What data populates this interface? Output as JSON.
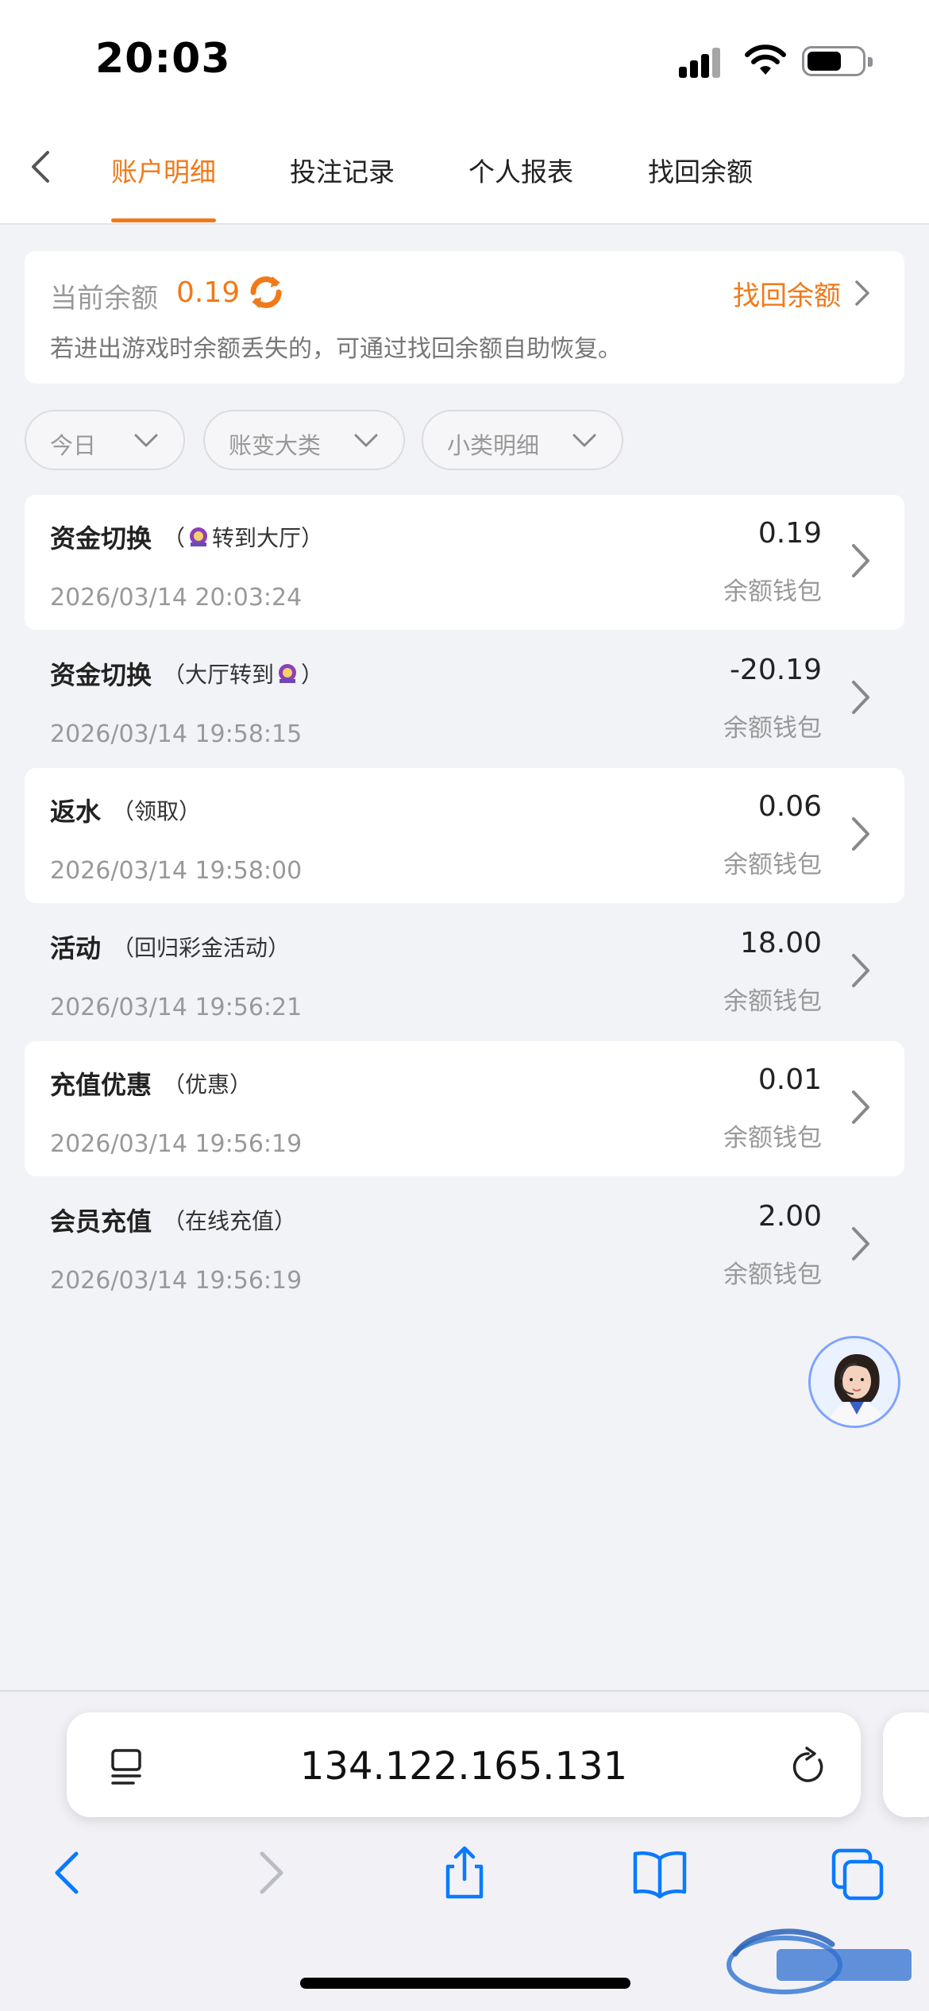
{
  "status_bar": {
    "time": "20:03"
  },
  "header": {
    "tabs": [
      {
        "label": "账户明细",
        "active": true
      },
      {
        "label": "投注记录",
        "active": false
      },
      {
        "label": "个人报表",
        "active": false
      },
      {
        "label": "找回余额",
        "active": false
      }
    ]
  },
  "balance": {
    "label": "当前余额",
    "value": "0.19",
    "recover_label": "找回余额",
    "note": "若进出游戏时余额丢失的，可通过找回余额自助恢复。"
  },
  "filters": [
    {
      "label": "今日"
    },
    {
      "label": "账变大类"
    },
    {
      "label": "小类明细"
    }
  ],
  "transactions": [
    {
      "title": "资金切换",
      "sub_prefix": "（",
      "sub_suffix": "转到大厅）",
      "has_logo": true,
      "logo_position": "prefix",
      "time": "2026/03/14 20:03:24",
      "amount": "0.19",
      "wallet": "余额钱包"
    },
    {
      "title": "资金切换",
      "sub_prefix": "（大厅转到",
      "sub_suffix": "）",
      "has_logo": true,
      "logo_position": "suffix",
      "time": "2026/03/14 19:58:15",
      "amount": "-20.19",
      "wallet": "余额钱包"
    },
    {
      "title": "返水",
      "sub_prefix": "（领取）",
      "sub_suffix": "",
      "has_logo": false,
      "time": "2026/03/14 19:58:00",
      "amount": "0.06",
      "wallet": "余额钱包"
    },
    {
      "title": "活动",
      "sub_prefix": "（回归彩金活动）",
      "sub_suffix": "",
      "has_logo": false,
      "time": "2026/03/14 19:56:21",
      "amount": "18.00",
      "wallet": "余额钱包"
    },
    {
      "title": "充值优惠",
      "sub_prefix": "（优惠）",
      "sub_suffix": "",
      "has_logo": false,
      "time": "2026/03/14 19:56:19",
      "amount": "0.01",
      "wallet": "余额钱包"
    },
    {
      "title": "会员充值",
      "sub_prefix": "（在线充值）",
      "sub_suffix": "",
      "has_logo": false,
      "time": "2026/03/14 19:56:19",
      "amount": "2.00",
      "wallet": "余额钱包"
    }
  ],
  "browser": {
    "url": "134.122.165.131"
  },
  "icons": {
    "back": "chevron-left-icon",
    "refresh": "refresh-icon",
    "chevron": "chevron-right-icon",
    "caret": "chevron-down-icon",
    "reader": "reader-mode-icon",
    "reload": "reload-icon",
    "share": "share-icon",
    "bookmarks": "bookmarks-icon",
    "tabs": "tabs-icon"
  },
  "colors": {
    "accent": "#f07a1a",
    "ios_blue": "#0a7aff",
    "muted": "#999999"
  }
}
